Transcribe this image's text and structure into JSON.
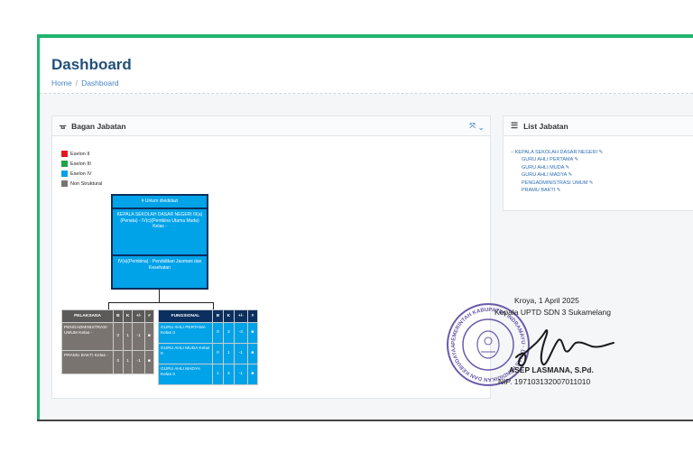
{
  "header": {
    "title": "Dashboard",
    "breadcrumb": [
      "Home",
      "Dashboard"
    ]
  },
  "bagan": {
    "title": "Bagan Jabatan",
    "legend": [
      {
        "label": "Eselon II",
        "color": "#e8141c"
      },
      {
        "label": "Eselon III",
        "color": "#1fa34a"
      },
      {
        "label": "Eselon IV",
        "color": "#00a2e8"
      },
      {
        "label": "Non Struktural",
        "color": "#7a7470"
      }
    ],
    "top_box": [
      "# Unlum divididazi",
      "KEPALA SEKOLAH DASAR NEGERI III(a)(Penata) - IV(c)(Pembina Utama Muda) Kelas -",
      "IV(a)(Pembina) - Pendidikan Jasmani dan Kesehatan"
    ],
    "pelaksana": {
      "headers": [
        "PELAKSANA",
        "B",
        "K",
        "+/-",
        "#"
      ],
      "rows": [
        [
          "PENGADMINISTRASI UMUM Kelas -",
          "0",
          "1",
          "-1",
          "■"
        ],
        [
          "PRAMU BAKTI Kelas -",
          "0",
          "1",
          "-1",
          "■"
        ]
      ]
    },
    "fungsional": {
      "headers": [
        "FUNGSIONAL",
        "B",
        "K",
        "+/-",
        "#"
      ],
      "rows": [
        [
          "GURU AHLI PERTAMA Kelas 0",
          "0",
          "3",
          "-3",
          "■"
        ],
        [
          "GURU AHLI MUDA Kelas 0",
          "0",
          "1",
          "-1",
          "■"
        ],
        [
          "GURU AHLI MADYA Kelas 0",
          "1",
          "3",
          "-1",
          "■"
        ]
      ]
    }
  },
  "list": {
    "title": "List Jabatan",
    "root": "KEPALA SEKOLAH DASAR NEGERI",
    "children": [
      "GURU AHLI PERTAMA",
      "GURU AHLI MUDA",
      "GURU AHLI MADYA",
      "PENGADMINISTRASI UMUM",
      "PRAMU BAKTI"
    ]
  },
  "signature": {
    "place_date": "Kroya, 1 April 2025",
    "position": "Kepala UPTD SDN 3 Sukamelang",
    "name": "ASEP LASMANA, S.Pd.",
    "nip": "NIP. 197103132007011010",
    "stamp_text": "PEMERINTAH KABUPATEN INDRAMAYU · DINAS PENDIDIKAN DAN KEBUDAYAAN · UPTD SDN 3 SUKAMELANG"
  }
}
